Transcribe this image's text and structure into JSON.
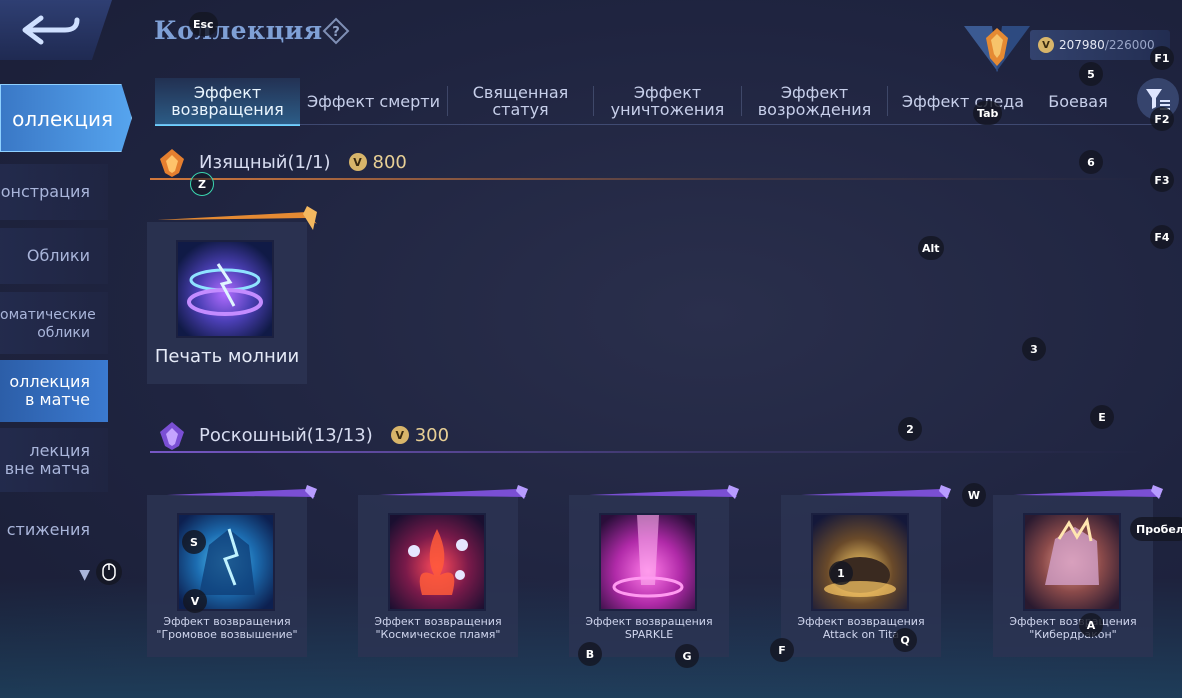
{
  "header": {
    "title": "Коллекция",
    "help_icon": "question-icon"
  },
  "currency": {
    "current": "207980",
    "max": "/226000",
    "icon": "collection-coin-icon"
  },
  "sidebar": {
    "items": [
      {
        "label": "оллекция",
        "state": "active"
      },
      {
        "label": "онстрация"
      },
      {
        "label": "Облики"
      },
      {
        "label": "оматические облики"
      },
      {
        "label": "оллекция в матче",
        "state": "sub-active"
      },
      {
        "label": "лекция вне матча"
      },
      {
        "label": "стижения"
      }
    ]
  },
  "tabs": [
    {
      "label": "Эффект возвращения",
      "active": true
    },
    {
      "label": "Эффект смерти"
    },
    {
      "label": "Священная статуя"
    },
    {
      "label": "Эффект уничтожения"
    },
    {
      "label": "Эффект возрождения"
    },
    {
      "label": "Эффект следа"
    },
    {
      "label": "Боевая"
    }
  ],
  "sections": [
    {
      "title": "Изящный(1/1)",
      "cost": "800",
      "color": "#e0863a"
    },
    {
      "title": "Роскошный(13/13)",
      "cost": "300",
      "color": "#8a5ae0"
    }
  ],
  "elegant_items": [
    {
      "name": "Печать молнии"
    }
  ],
  "luxury_items": [
    {
      "name": "Эффект возвращения \"Громовое возвышение\""
    },
    {
      "name": "Эффект возвращения \"Космическое пламя\""
    },
    {
      "name": "Эффект возвращения SPARKLE"
    },
    {
      "name": "Эффект возвращения Attack on Tita"
    },
    {
      "name": "Эффект возвращения \"Кибердракон\""
    }
  ],
  "key_hints": {
    "esc": "Esc",
    "f1": "F1",
    "f2": "F2",
    "f3": "F3",
    "f4": "F4",
    "tab": "Tab",
    "n5": "5",
    "n6": "6",
    "z": "Z",
    "alt": "Alt",
    "n3": "3",
    "n2": "2",
    "e": "E",
    "w": "W",
    "space": "Пробел",
    "s": "S",
    "v": "V",
    "n1": "1",
    "a": "A",
    "b": "B",
    "g": "G",
    "f": "F",
    "q": "Q"
  }
}
